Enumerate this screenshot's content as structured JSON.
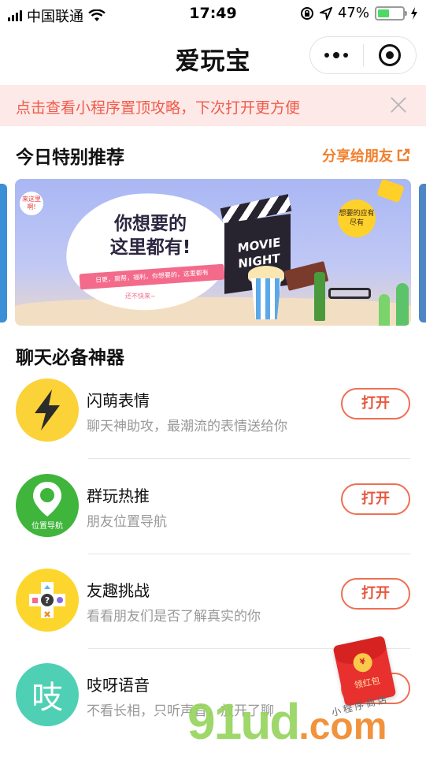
{
  "status_bar": {
    "carrier": "中国联通",
    "time": "17:49",
    "battery_percent": "47%",
    "battery_level": 0.47,
    "battery_color": "#4cd964"
  },
  "nav": {
    "title": "爱玩宝",
    "more_icon": "more-dots-icon",
    "close_icon": "target-close-icon"
  },
  "tip": {
    "text": "点击查看小程序置顶攻略，下次打开更方便",
    "close_icon": "close-icon",
    "bg_color": "#fde9e7",
    "text_color": "#ef5b4b"
  },
  "featured": {
    "title": "今日特别推荐",
    "share_label": "分享给朋友",
    "share_icon": "share-icon",
    "banner": {
      "headline_line1": "你想要的",
      "headline_line2": "这里都有!",
      "ribbon": "日更，腐帮，福利，你想要的，这里都有",
      "cta": "还不快来~",
      "bubble_left": "来这里啊!",
      "bubble_right": "想要的应有尽有",
      "clapper_line1": "MOVIE",
      "clapper_line2": "NIGHT"
    }
  },
  "chat_tools": {
    "title": "聊天必备神器",
    "items": [
      {
        "name": "闪萌表情",
        "desc": "聊天神助攻，最潮流的表情送给你",
        "button": "打开",
        "icon": "lightning-icon",
        "icon_bg": "#fbd237"
      },
      {
        "name": "群玩热推",
        "desc": "朋友位置导航",
        "button": "打开",
        "icon": "location-pin-icon",
        "icon_label": "位置导航",
        "icon_bg": "#3fb53b"
      },
      {
        "name": "友趣挑战",
        "desc": "看看朋友们是否了解真实的你",
        "button": "打开",
        "icon": "gamepad-question-icon",
        "icon_bg": "#fcd62d"
      },
      {
        "name": "吱呀语音",
        "desc": "不看长相，只听声音，放开了聊",
        "button": "打开",
        "icon": "voice-zhi-icon",
        "icon_char": "吱",
        "icon_bg": "#4fd0b4"
      }
    ]
  },
  "red_packet": {
    "label": "领红包",
    "coin": "¥",
    "icon": "red-envelope-icon"
  },
  "watermark": {
    "text": "91ud",
    "suffix": ".com",
    "sub": "小程序商店"
  },
  "colors": {
    "accent": "#f17f2c",
    "button_border": "#ef6f52",
    "button_text": "#e8573c"
  }
}
